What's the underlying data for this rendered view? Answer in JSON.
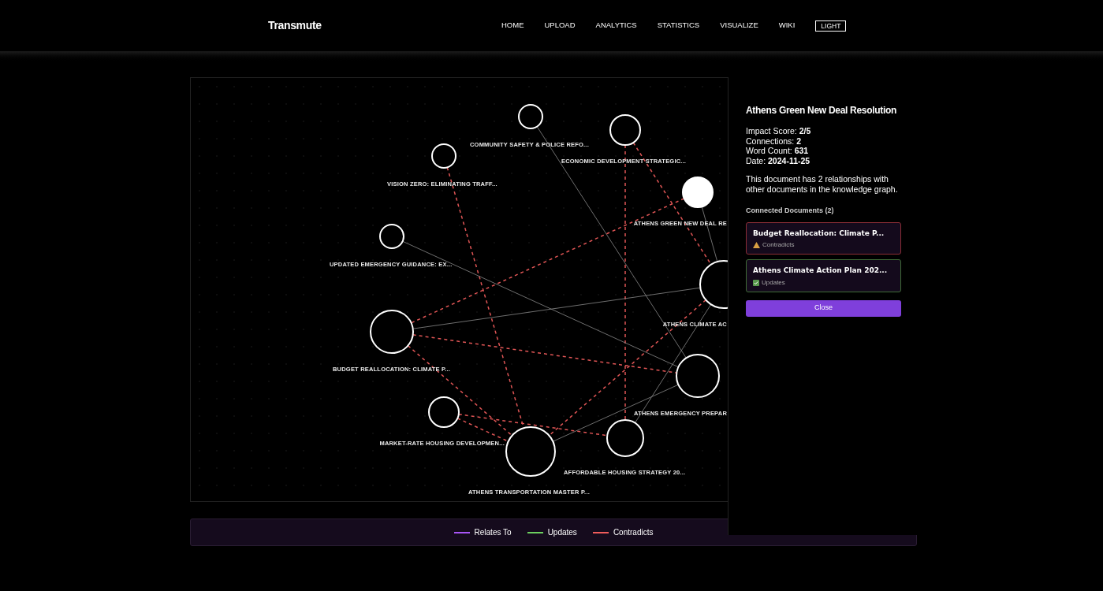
{
  "header": {
    "logo": "Transmute",
    "nav": [
      {
        "label": "HOME"
      },
      {
        "label": "UPLOAD"
      },
      {
        "label": "ANALYTICS"
      },
      {
        "label": "STATISTICS"
      },
      {
        "label": "VISUALIZE"
      },
      {
        "label": "WIKI"
      }
    ],
    "theme_button": "LIGHT"
  },
  "graph": {
    "nodes": [
      {
        "label": "COMMUNITY SAFETY & POLICE REFO...",
        "selected": false
      },
      {
        "label": "ECONOMIC DEVELOPMENT STRATEGIC...",
        "selected": false
      },
      {
        "label": "VISION ZERO: ELIMINATING TRAFF...",
        "selected": false
      },
      {
        "label": "ATHENS GREEN NEW DEAL RE",
        "selected": true
      },
      {
        "label": "UPDATED EMERGENCY GUIDANCE: EX...",
        "selected": false
      },
      {
        "label": "ATHENS CLIMATE AC",
        "selected": false
      },
      {
        "label": "BUDGET REALLOCATION: CLIMATE P...",
        "selected": false
      },
      {
        "label": "ATHENS EMERGENCY PREPAR",
        "selected": false
      },
      {
        "label": "MARKET-RATE HOUSING DEVELOPMEN...",
        "selected": false
      },
      {
        "label": "ATHENS TRANSPORTATION MASTER P...",
        "selected": false
      },
      {
        "label": "AFFORDABLE HOUSING STRATEGY 20...",
        "selected": false
      }
    ],
    "edges": [
      {
        "kind": "relates"
      },
      {
        "kind": "contradicts"
      },
      {
        "kind": "contradicts"
      },
      {
        "kind": "contradicts"
      },
      {
        "kind": "contradicts"
      },
      {
        "kind": "relates"
      },
      {
        "kind": "relates"
      },
      {
        "kind": "relates"
      },
      {
        "kind": "contradicts"
      },
      {
        "kind": "relates"
      },
      {
        "kind": "contradicts"
      },
      {
        "kind": "contradicts"
      },
      {
        "kind": "contradicts"
      },
      {
        "kind": "contradicts"
      },
      {
        "kind": "relates"
      }
    ]
  },
  "details": {
    "title": "Athens Green New Deal Resolution",
    "stats": [
      {
        "label": "Impact Score:",
        "value": "2/5"
      },
      {
        "label": "Connections:",
        "value": "2"
      },
      {
        "label": "Word Count:",
        "value": "631"
      },
      {
        "label": "Date:",
        "value": "2024-11-25"
      }
    ],
    "summary": "This document has 2 relationships with other documents in the knowledge graph.",
    "connected_heading": "Connected Documents (2)",
    "connected": [
      {
        "title": "Budget Reallocation: Climate P...",
        "kind": "contradicts",
        "relation": "Contradicts"
      },
      {
        "title": "Athens Climate Action Plan 202...",
        "kind": "updates",
        "relation": "Updates"
      }
    ],
    "close_button": "Close"
  },
  "legend": [
    {
      "label": "Relates To",
      "color": "#a855f7"
    },
    {
      "label": "Updates",
      "color": "#6ccf5f"
    },
    {
      "label": "Contradicts",
      "color": "#ef5b5b"
    }
  ]
}
